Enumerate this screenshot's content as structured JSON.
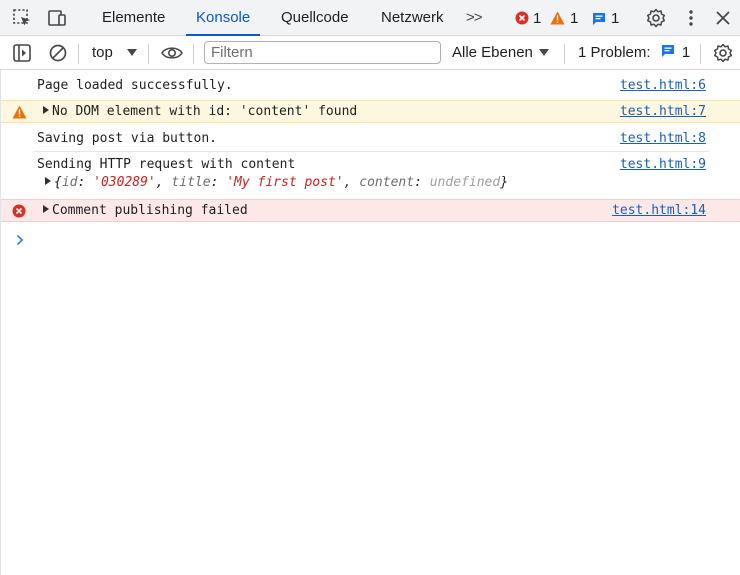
{
  "tabs": {
    "items": [
      "Elemente",
      "Konsole",
      "Quellcode",
      "Netzwerk"
    ],
    "active": "Konsole",
    "more_label": ">>"
  },
  "counts": {
    "errors": "1",
    "warnings": "1",
    "info": "1"
  },
  "toolbar": {
    "context": "top",
    "filter_placeholder": "Filtern",
    "levels": "Alle Ebenen",
    "problems_label": "1 Problem:",
    "problems_count": "1"
  },
  "messages": [
    {
      "type": "log",
      "text": "Page loaded successfully.",
      "source": "test.html:6"
    },
    {
      "type": "warning",
      "text": "No DOM element with id: 'content' found",
      "source": "test.html:7"
    },
    {
      "type": "log",
      "text": "Saving post via button.",
      "source": "test.html:8"
    },
    {
      "type": "log",
      "text": "Sending HTTP request with content",
      "source": "test.html:9",
      "object": {
        "id_key": "id",
        "id_val": "'030289'",
        "title_key": "title",
        "title_val": "'My first post'",
        "content_key": "content",
        "content_val": "undefined"
      }
    },
    {
      "type": "error",
      "text": "Comment publishing failed",
      "source": "test.html:14"
    }
  ],
  "colors": {
    "accent": "#0b57d0",
    "error": "#d93025",
    "warning": "#e8710a",
    "info": "#1a73e8"
  },
  "icons": [
    "inspect-icon",
    "device-toggle-icon",
    "error-icon",
    "warning-icon",
    "info-icon",
    "gear-icon",
    "kebab-menu-icon",
    "close-icon",
    "sidebar-toggle-icon",
    "clear-console-icon",
    "eye-icon",
    "chevron-right-icon"
  ]
}
